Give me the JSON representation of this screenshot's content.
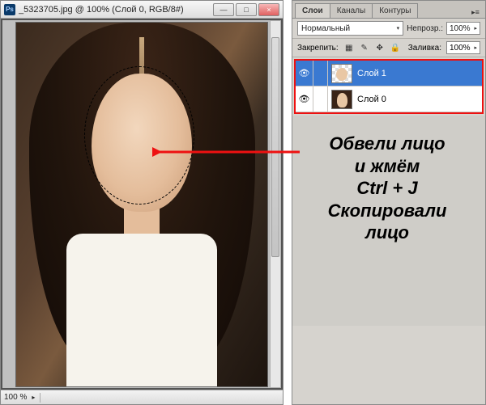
{
  "document": {
    "ps_icon_label": "Ps",
    "title": "_5323705.jpg @ 100% (Слой 0, RGB/8#)",
    "zoom": "100 %"
  },
  "win_buttons": {
    "min": "—",
    "max": "□",
    "close": "×"
  },
  "panel": {
    "tabs": {
      "layers": "Слои",
      "channels": "Каналы",
      "paths": "Контуры"
    },
    "menu_glyph": "▸≡",
    "blend_mode": "Нормальный",
    "blend_arrow": "▾",
    "opacity_label": "Непрозр.:",
    "opacity_value": "100%",
    "lock_label": "Закрепить:",
    "lock_icons": {
      "pixels": "▦",
      "brush": "✎",
      "move": "✥",
      "all": "🔒"
    },
    "fill_label": "Заливка:",
    "fill_value": "100%"
  },
  "layers": [
    {
      "eye": "👁",
      "name": "Слой 1",
      "selected": true,
      "thumb": "face"
    },
    {
      "eye": "👁",
      "name": "Слой 0",
      "selected": false,
      "thumb": "photo"
    }
  ],
  "annotation": {
    "line1": "Обвели лицо",
    "line2": "и жмём",
    "line3": "Ctrl + J",
    "line4": "Скопировали",
    "line5": "лицо"
  }
}
